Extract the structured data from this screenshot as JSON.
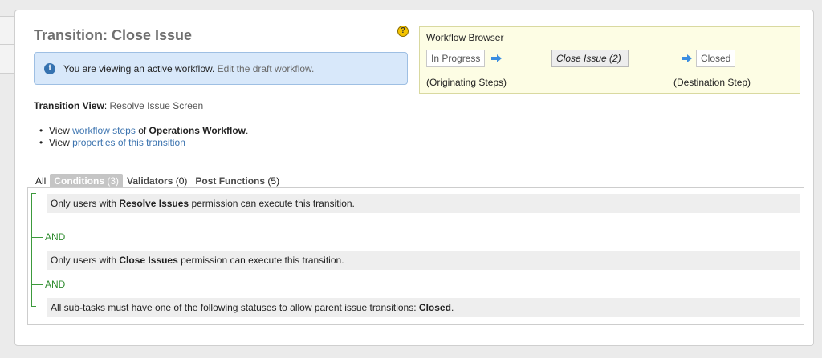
{
  "page": {
    "title": "Transition: Close Issue",
    "help_icon": "help-icon"
  },
  "info": {
    "icon": "info-icon",
    "text": "You are viewing an active workflow.",
    "link": "Edit the draft workflow."
  },
  "workflow_browser": {
    "title": "Workflow Browser",
    "from_step": "In Progress",
    "current": "Close Issue (2)",
    "to_step": "Closed",
    "originating_caption": "(Originating Steps)",
    "destination_caption": "(Destination Step)",
    "arrow_icon": "right-arrow-icon"
  },
  "transition_view": {
    "label": "Transition View",
    "value": "Resolve Issue Screen"
  },
  "links": {
    "view1_prefix": "View",
    "view1_link": "workflow steps",
    "view1_of": "of",
    "view1_bold": "Operations Workflow",
    "view1_suffix": ".",
    "view2_prefix": "View",
    "view2_link": "properties of this transition"
  },
  "tabs": [
    {
      "label": "All",
      "count": ""
    },
    {
      "label": "Conditions",
      "count": "(3)"
    },
    {
      "label": "Validators",
      "count": "(0)"
    },
    {
      "label": "Post Functions",
      "count": "(5)"
    }
  ],
  "conditions": {
    "c1_pre": "Only users with",
    "c1_bold": "Resolve Issues",
    "c1_post": "permission can execute this transition.",
    "and1": "AND",
    "c2_pre": "Only users with",
    "c2_bold": "Close Issues",
    "c2_post": "permission can execute this transition.",
    "and2": "AND",
    "c3_pre": "All sub-tasks must have one of the following statuses to allow parent issue transitions:",
    "c3_bold": "Closed",
    "c3_post": "."
  },
  "colors": {
    "accent_link": "#3b73af",
    "and_green": "#2e8b2e",
    "info_bg": "#d8e8fa",
    "wf_bg": "#fdfde4"
  }
}
